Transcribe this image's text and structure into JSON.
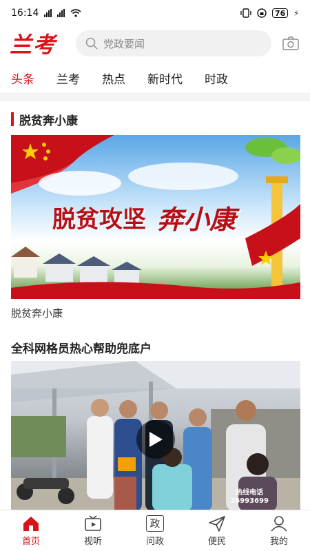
{
  "status_bar": {
    "time": "16:14",
    "battery": "76"
  },
  "header": {
    "logo_text": "兰考",
    "search_placeholder": "党政要闻"
  },
  "tabs": [
    {
      "label": "头条",
      "active": true
    },
    {
      "label": "兰考",
      "active": false
    },
    {
      "label": "热点",
      "active": false
    },
    {
      "label": "新时代",
      "active": false
    },
    {
      "label": "时政",
      "active": false
    }
  ],
  "section": {
    "title": "脱贫奔小康",
    "banner_text_left": "脱贫攻坚",
    "banner_text_right": "奔小康",
    "caption": "脱贫奔小康"
  },
  "article": {
    "title": "全科网格员热心帮助兜底户",
    "hotline_label": "热线电话",
    "hotline_number": "26993699"
  },
  "bottom_nav": [
    {
      "label": "首页",
      "icon": "home-icon",
      "active": true
    },
    {
      "label": "视听",
      "icon": "tv-icon",
      "active": false
    },
    {
      "label": "问政",
      "icon": "zheng-icon",
      "icon_text": "政",
      "active": false
    },
    {
      "label": "便民",
      "icon": "send-icon",
      "active": false
    },
    {
      "label": "我的",
      "icon": "user-icon",
      "active": false
    }
  ],
  "colors": {
    "accent": "#d7141a"
  }
}
